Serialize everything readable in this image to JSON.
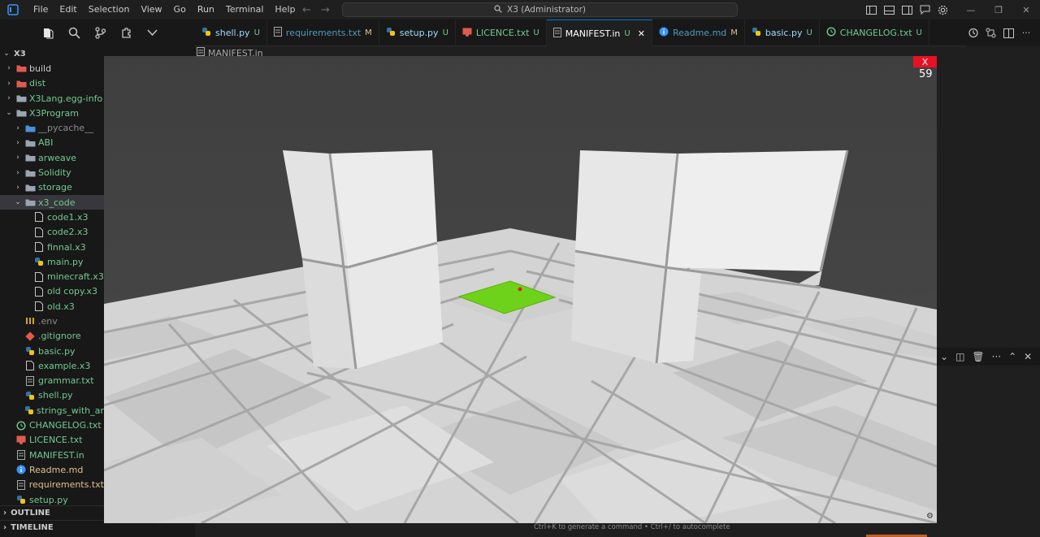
{
  "menu": [
    "File",
    "Edit",
    "Selection",
    "View",
    "Go",
    "Run",
    "Terminal",
    "Help"
  ],
  "command_center": "X3 (Administrator)",
  "tabs": [
    {
      "label": "shell.py",
      "status": "U",
      "icon": "python-icon",
      "color": "#9cdcfe",
      "status_color": "#73c991"
    },
    {
      "label": "requirements.txt",
      "status": "M",
      "icon": "file-lines-icon",
      "color": "#519aba",
      "status_color": "#e2c08d"
    },
    {
      "label": "setup.py",
      "status": "U",
      "icon": "python-icon",
      "color": "#9cdcfe",
      "status_color": "#73c991"
    },
    {
      "label": "LICENCE.txt",
      "status": "U",
      "icon": "license-icon",
      "color": "#73c991",
      "status_color": "#73c991"
    },
    {
      "label": "MANIFEST.in",
      "status": "U",
      "icon": "file-lines-icon",
      "color": "#ffffff",
      "status_color": "#73c991",
      "active": true
    },
    {
      "label": "Readme.md",
      "status": "M",
      "icon": "info-icon",
      "color": "#519aba",
      "status_color": "#e2c08d"
    },
    {
      "label": "basic.py",
      "status": "U",
      "icon": "python-icon",
      "color": "#9cdcfe",
      "status_color": "#73c991"
    },
    {
      "label": "CHANGELOG.txt",
      "status": "U",
      "icon": "changelog-icon",
      "color": "#73c991",
      "status_color": "#73c991"
    }
  ],
  "breadcrumb": "MANIFEST.in",
  "explorer": {
    "root": "X3",
    "items": [
      {
        "label": "build",
        "depth": 1,
        "chev": "›",
        "icon": "red-folder",
        "color": "#cccccc"
      },
      {
        "label": "dist",
        "depth": 1,
        "chev": "›",
        "icon": "red-folder",
        "color": "#73c991"
      },
      {
        "label": "X3Lang.egg-info",
        "depth": 1,
        "chev": "›",
        "icon": "folder",
        "color": "#73c991"
      },
      {
        "label": "X3Program",
        "depth": 1,
        "chev": "⌄",
        "icon": "folder",
        "color": "#73c991"
      },
      {
        "label": "__pycache__",
        "depth": 2,
        "chev": "›",
        "icon": "blue-folder",
        "color": "#8c8c8c"
      },
      {
        "label": "ABI",
        "depth": 2,
        "chev": "›",
        "icon": "folder",
        "color": "#73c991"
      },
      {
        "label": "arweave",
        "depth": 2,
        "chev": "›",
        "icon": "folder",
        "color": "#73c991"
      },
      {
        "label": "Solidity",
        "depth": 2,
        "chev": "›",
        "icon": "folder",
        "color": "#73c991"
      },
      {
        "label": "storage",
        "depth": 2,
        "chev": "›",
        "icon": "folder",
        "color": "#73c991"
      },
      {
        "label": "x3_code",
        "depth": 2,
        "chev": "⌄",
        "icon": "folder",
        "color": "#73c991",
        "selected": true
      },
      {
        "label": "code1.x3",
        "depth": 3,
        "chev": "",
        "icon": "file",
        "color": "#73c991"
      },
      {
        "label": "code2.x3",
        "depth": 3,
        "chev": "",
        "icon": "file",
        "color": "#73c991"
      },
      {
        "label": "finnal.x3",
        "depth": 3,
        "chev": "",
        "icon": "file",
        "color": "#73c991"
      },
      {
        "label": "main.py",
        "depth": 3,
        "chev": "",
        "icon": "python",
        "color": "#73c991"
      },
      {
        "label": "minecraft.x3",
        "depth": 3,
        "chev": "",
        "icon": "file",
        "color": "#73c991"
      },
      {
        "label": "old copy.x3",
        "depth": 3,
        "chev": "",
        "icon": "file",
        "color": "#73c991"
      },
      {
        "label": "old.x3",
        "depth": 3,
        "chev": "",
        "icon": "file",
        "color": "#73c991"
      },
      {
        "label": ".env",
        "depth": 2,
        "chev": "",
        "icon": "env",
        "color": "#8c8c8c"
      },
      {
        "label": ".gitignore",
        "depth": 2,
        "chev": "",
        "icon": "git",
        "color": "#73c991"
      },
      {
        "label": "basic.py",
        "depth": 2,
        "chev": "",
        "icon": "python",
        "color": "#73c991"
      },
      {
        "label": "example.x3",
        "depth": 2,
        "chev": "",
        "icon": "file",
        "color": "#73c991"
      },
      {
        "label": "grammar.txt",
        "depth": 2,
        "chev": "",
        "icon": "lines",
        "color": "#73c991"
      },
      {
        "label": "shell.py",
        "depth": 2,
        "chev": "",
        "icon": "python",
        "color": "#73c991"
      },
      {
        "label": "strings_with_arr",
        "depth": 2,
        "chev": "",
        "icon": "python",
        "color": "#73c991"
      },
      {
        "label": "CHANGELOG.txt",
        "depth": 1,
        "chev": "",
        "icon": "changelog",
        "color": "#73c991"
      },
      {
        "label": "LICENCE.txt",
        "depth": 1,
        "chev": "",
        "icon": "license",
        "color": "#73c991"
      },
      {
        "label": "MANIFEST.in",
        "depth": 1,
        "chev": "",
        "icon": "lines",
        "color": "#73c991"
      },
      {
        "label": "Readme.md",
        "depth": 1,
        "chev": "",
        "icon": "info",
        "color": "#e2c08d"
      },
      {
        "label": "requirements.txt",
        "depth": 1,
        "chev": "",
        "icon": "lines",
        "color": "#e2c08d"
      },
      {
        "label": "setup.py",
        "depth": 1,
        "chev": "",
        "icon": "python",
        "color": "#73c991"
      }
    ],
    "sections": [
      "OUTLINE",
      "TIMELINE"
    ]
  },
  "game": {
    "close_label": "X",
    "fps": "59",
    "highlight_color": "#6fd21a",
    "wall_color": "#e6e6e6",
    "sky_color": "#444444"
  },
  "footer_hint": "Ctrl+K to generate a command • Ctrl+/ to autocomplete"
}
